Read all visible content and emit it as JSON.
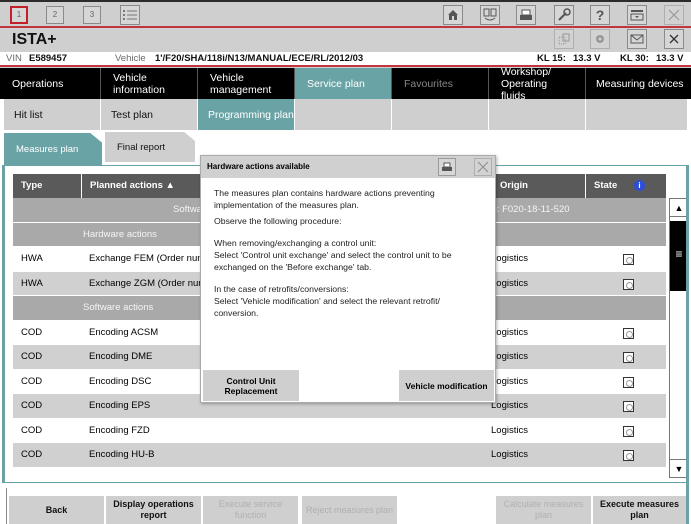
{
  "topbar": {
    "sessions": [
      "1",
      "2",
      "3"
    ],
    "active_session": "1",
    "icons": [
      "list-icon",
      "home-icon",
      "compare-icon",
      "print-icon",
      "wrench-icon",
      "help-icon",
      "dropdown-icon",
      "close-icon"
    ]
  },
  "app": {
    "title": "ISTA+"
  },
  "vehicle_bar": {
    "vin_label": "VIN",
    "vin": "E589457",
    "vehicle_label": "Vehicle",
    "vehicle": "1'/F20/SHA/118i/N13/MANUAL/ECE/RL/2012/03",
    "kl15_label": "KL 15:",
    "kl15_value": "13.3 V",
    "kl30_label": "KL 30:",
    "kl30_value": "13.3 V"
  },
  "main_nav": [
    {
      "label": "Operations",
      "active": false
    },
    {
      "label": "Vehicle information",
      "active": false
    },
    {
      "label": "Vehicle management",
      "active": false
    },
    {
      "label": "Service plan",
      "active": true
    },
    {
      "label": "Favourites",
      "active": false
    },
    {
      "label": "Workshop/ Operating fluids",
      "active": false
    },
    {
      "label": "Measuring devices",
      "active": false
    }
  ],
  "sub_nav": [
    {
      "label": "Hit list"
    },
    {
      "label": "Test plan"
    },
    {
      "label": "Programming plan",
      "active": true
    },
    {
      "label": ""
    },
    {
      "label": ""
    },
    {
      "label": ""
    },
    {
      "label": ""
    }
  ],
  "tabs": [
    {
      "label": "Measures plan",
      "active": true
    },
    {
      "label": "Final report",
      "active": false
    }
  ],
  "table": {
    "columns": [
      "Type",
      "Planned actions ▲",
      "Origin",
      "State"
    ],
    "header_row": "Software (target): F020-18-11-520",
    "header_row_left": "Softwa",
    "header_row_right": "t): F020-18-11-520",
    "groups": [
      {
        "label": "Hardware actions",
        "rows": [
          {
            "type": "HWA",
            "action": "Exchange FEM (Order num",
            "origin": "Logistics"
          },
          {
            "type": "HWA",
            "action": "Exchange ZGM (Order num",
            "origin": "Logistics"
          }
        ]
      },
      {
        "label": "Software actions",
        "rows": [
          {
            "type": "COD",
            "action": "Encoding ACSM",
            "origin": "Logistics"
          },
          {
            "type": "COD",
            "action": "Encoding DME",
            "origin": "Logistics"
          },
          {
            "type": "COD",
            "action": "Encoding DSC",
            "origin": "Logistics"
          },
          {
            "type": "COD",
            "action": "Encoding EPS",
            "origin": "Logistics"
          },
          {
            "type": "COD",
            "action": "Encoding FZD",
            "origin": "Logistics"
          },
          {
            "type": "COD",
            "action": "Encoding HU-B",
            "origin": "Logistics"
          }
        ]
      }
    ]
  },
  "dialog": {
    "title": "Hardware actions available",
    "p1": "The measures plan contains hardware actions preventing implementation of the measures plan.",
    "p2": "Observe the following procedure:",
    "p3a": "When removing/exchanging a control unit:",
    "p3b": "Select 'Control unit exchange' and select the control unit to be exchanged on the 'Before exchange' tab.",
    "p4a": "In the case of retrofits/conversions:",
    "p4b": "Select 'Vehicle modification' and select the relevant retrofit/ conversion.",
    "btn_left": "Control Unit Replacement",
    "btn_right": "Vehicle modification"
  },
  "bottom_buttons": [
    {
      "label": "Back",
      "enabled": true
    },
    {
      "label": "Display operations report",
      "enabled": true
    },
    {
      "label": "Execute service function",
      "enabled": false
    },
    {
      "label": "Reject measures plan",
      "enabled": false
    },
    {
      "label": "Calculate measures plan",
      "enabled": false
    },
    {
      "label": "Execute measures plan",
      "enabled": true
    }
  ],
  "colors": {
    "accent": "#6aa3a5",
    "brand_red": "#c0353f",
    "header_dark": "#5a5a5a"
  }
}
